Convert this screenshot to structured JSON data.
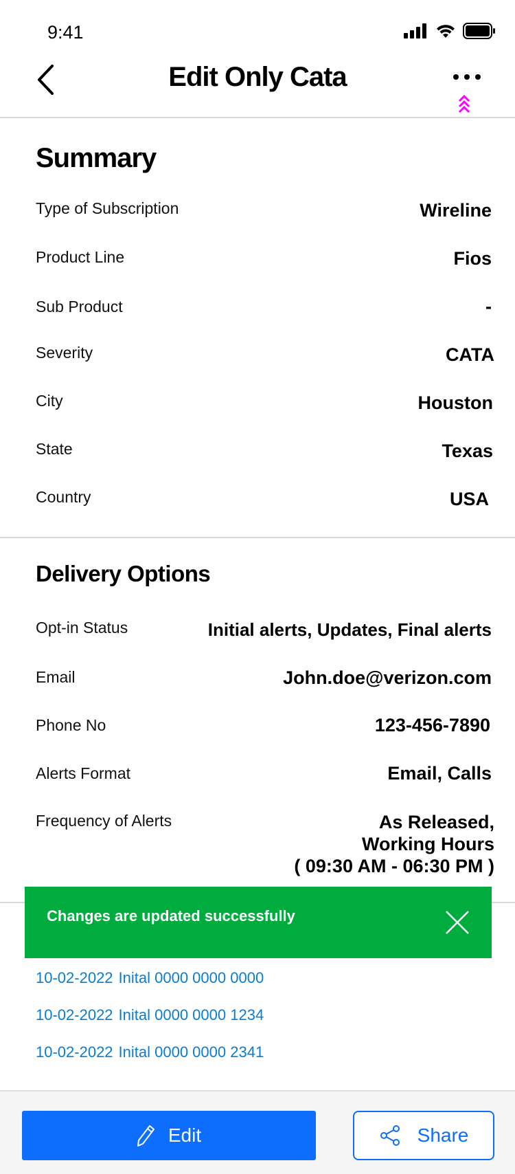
{
  "status_bar": {
    "time": "9:41"
  },
  "header": {
    "title": "Edit Only Cata"
  },
  "summary": {
    "title": "Summary",
    "rows": [
      {
        "label": "Type of Subscription",
        "value": "Wireline"
      },
      {
        "label": "Product Line",
        "value": "Fios"
      },
      {
        "label": "Sub Product",
        "value": "-"
      },
      {
        "label": "Severity",
        "value": "CATA"
      },
      {
        "label": "City",
        "value": "Houston"
      },
      {
        "label": "State",
        "value": "Texas"
      },
      {
        "label": "Country",
        "value": "USA"
      }
    ]
  },
  "delivery": {
    "title": "Delivery Options",
    "rows": [
      {
        "label": "Opt-in Status",
        "value": "Initial alerts, Updates, Final alerts"
      },
      {
        "label": "Email",
        "value": "John.doe@verizon.com"
      },
      {
        "label": "Phone No",
        "value": "123-456-7890"
      },
      {
        "label": "Alerts Format",
        "value": "Email, Calls"
      },
      {
        "label": "Frequency of Alerts",
        "value_lines": [
          "As Released,",
          "Working Hours",
          "( 09:30 AM - 06:30 PM )"
        ]
      }
    ]
  },
  "toast": {
    "message": "Changes are updated successfully"
  },
  "history": [
    {
      "date": "10-02-2022",
      "text": "Inital 0000 0000 0000"
    },
    {
      "date": "10-02-2022",
      "text": "Inital 0000 0000 1234"
    },
    {
      "date": "10-02-2022",
      "text": "Inital 0000 0000 2341"
    }
  ],
  "footer": {
    "edit_label": "Edit",
    "share_label": "Share"
  },
  "colors": {
    "primary": "#0d6efd",
    "success": "#00ac3e",
    "link": "#0a7dd0",
    "accent_icon": "#ff00ff"
  },
  "icons": [
    "signal-icon",
    "wifi-icon",
    "battery-icon",
    "back-chevron-icon",
    "more-icon",
    "double-chevron-up-icon",
    "close-icon",
    "pencil-icon",
    "share-icon"
  ]
}
